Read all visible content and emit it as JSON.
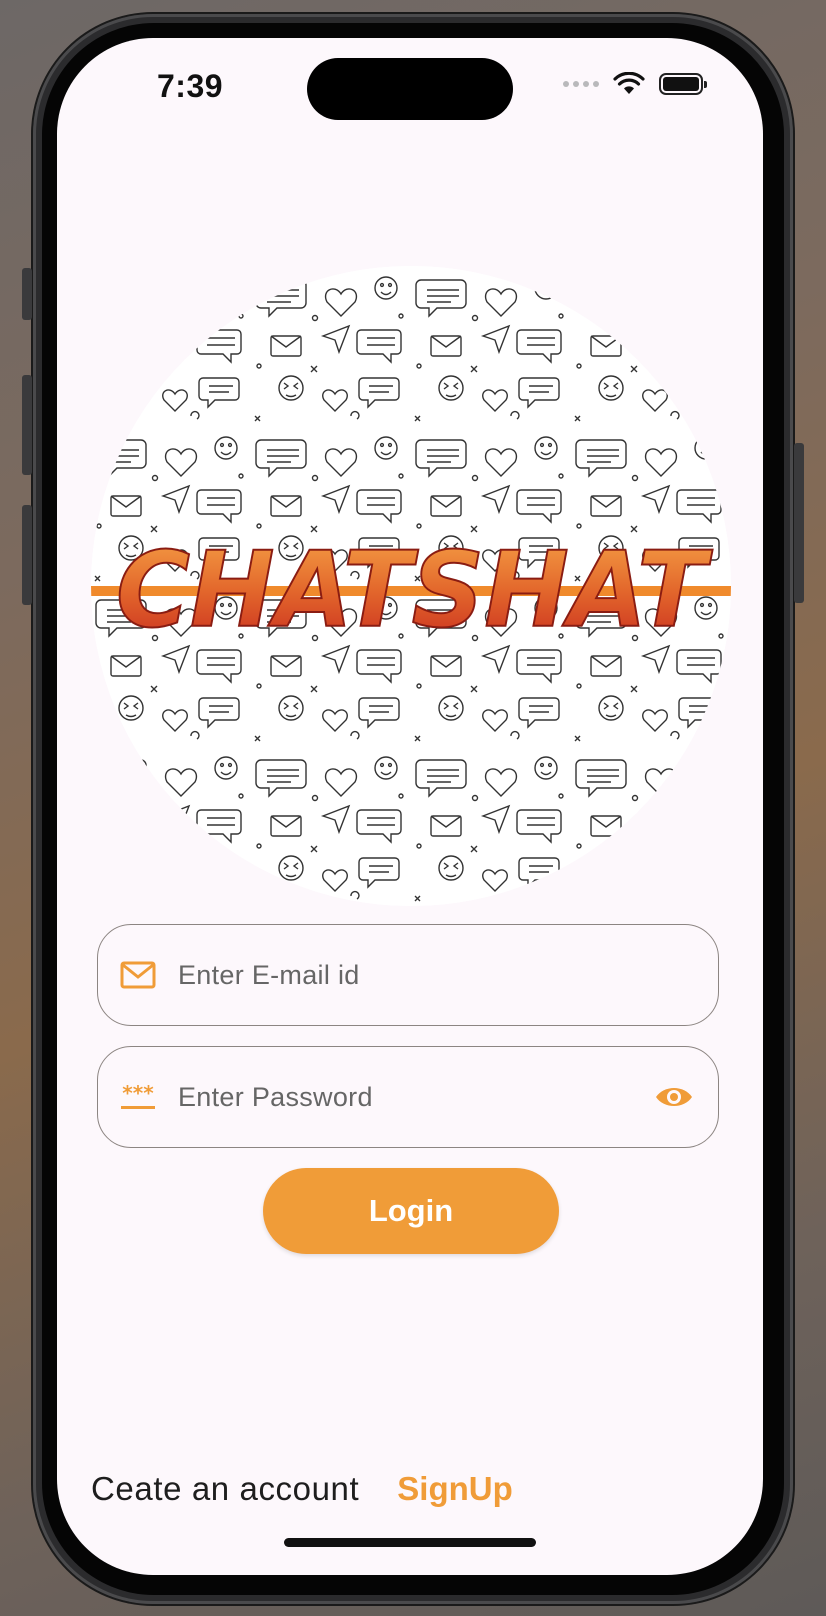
{
  "status_bar": {
    "time": "7:39",
    "icons": [
      "signal-dots",
      "wifi",
      "battery"
    ]
  },
  "logo": {
    "text": "CHATSHAT",
    "colors": {
      "fill_top": "#f6a347",
      "fill_bottom": "#c82a1e",
      "stripe": "#f08a2c"
    }
  },
  "email_field": {
    "placeholder": "Enter E-mail id",
    "value": "",
    "icon": "mail-icon"
  },
  "password_field": {
    "placeholder": "Enter Password",
    "value": "",
    "icon": "password-icon",
    "toggle_icon": "eye-icon"
  },
  "login_button": {
    "label": "Login"
  },
  "signup": {
    "prompt": "Ceate an account",
    "link": "SignUp"
  },
  "theme": {
    "accent": "#f09c38",
    "background": "#fdf8fc",
    "border": "#8c8582"
  }
}
